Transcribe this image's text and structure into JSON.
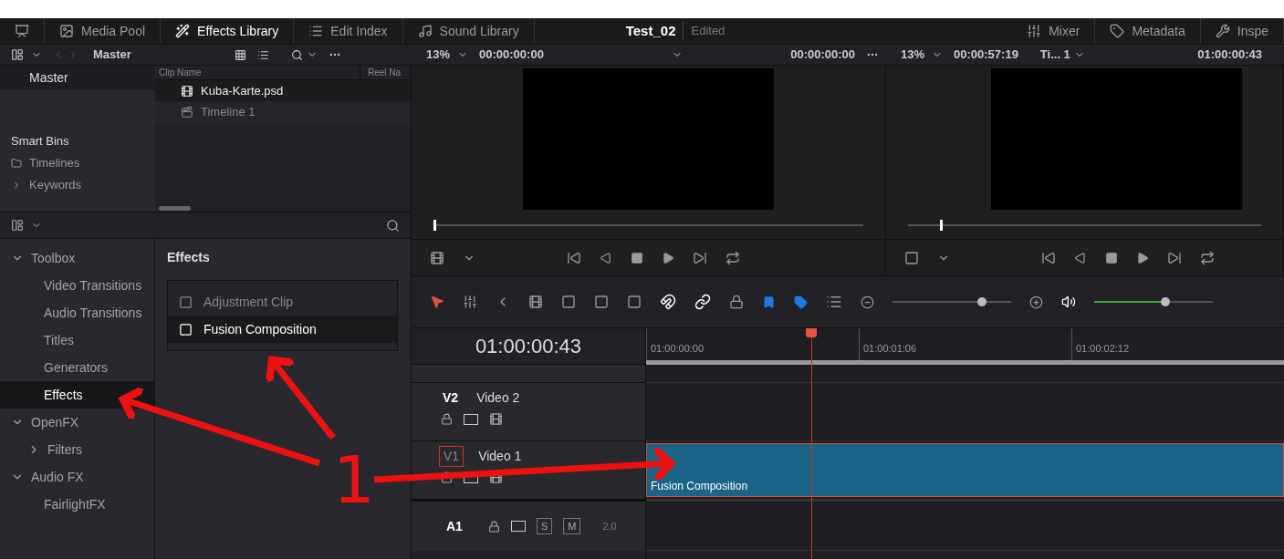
{
  "top_bar": {
    "left_tabs": [
      {
        "label": "Media Pool",
        "selected": false
      },
      {
        "label": "Effects Library",
        "selected": true
      },
      {
        "label": "Edit Index",
        "selected": false
      },
      {
        "label": "Sound Library",
        "selected": false
      }
    ],
    "project_title": "Test_02",
    "project_status": "Edited",
    "right_tabs": [
      {
        "label": "Mixer",
        "selected": false
      },
      {
        "label": "Metadata",
        "selected": false
      },
      {
        "label": "Inspe",
        "selected": false
      }
    ]
  },
  "media_pool": {
    "bin": "Master",
    "sidebar": [
      {
        "label": "Master",
        "kind": "bin",
        "selected": true
      },
      {
        "label": "Smart Bins",
        "kind": "heading"
      },
      {
        "label": "Timelines",
        "kind": "smart"
      },
      {
        "label": "Keywords",
        "kind": "group"
      }
    ],
    "columns": [
      "Clip Name",
      "Reel Na"
    ],
    "clips": [
      {
        "name": "Kuba-Karte.psd",
        "kind": "image",
        "selected": true
      },
      {
        "name": "Timeline 1",
        "kind": "timeline",
        "selected": false
      }
    ]
  },
  "effects_library": {
    "tree": [
      {
        "label": "Toolbox",
        "expanded": true,
        "children": [
          {
            "label": "Video Transitions",
            "selected": false
          },
          {
            "label": "Audio Transitions",
            "selected": false
          },
          {
            "label": "Titles",
            "selected": false
          },
          {
            "label": "Generators",
            "selected": false
          },
          {
            "label": "Effects",
            "selected": true
          }
        ]
      },
      {
        "label": "OpenFX",
        "expanded": true,
        "children": [
          {
            "label": "Filters",
            "expanded": false,
            "selected": false
          }
        ]
      },
      {
        "label": "Audio FX",
        "expanded": true,
        "children": [
          {
            "label": "FairlightFX",
            "selected": false
          }
        ]
      }
    ],
    "heading": "Effects",
    "items": [
      {
        "label": "Adjustment Clip",
        "selected": false
      },
      {
        "label": "Fusion Composition",
        "selected": true
      }
    ]
  },
  "source_viewer": {
    "zoom": "13%",
    "timecode": "00:00:00:00",
    "end_timecode": "00:00:00:00",
    "level": 0.0
  },
  "timeline_viewer": {
    "zoom": "13%",
    "duration": "00:00:57:19",
    "timeline": "Ti... 1",
    "timecode": "01:00:00:43",
    "level": 0.09
  },
  "toolbar": {
    "zoom_slider": {
      "level": 0.75
    },
    "volume_slider": {
      "level": 0.6
    }
  },
  "timeline": {
    "timecode": "01:00:00:43",
    "ruler": [
      "01:00:00:00",
      "01:00:01:06",
      "01:00:02:12"
    ],
    "tracks": [
      {
        "kind": "video",
        "id": "V2",
        "name": "Video 2",
        "selected": false
      },
      {
        "kind": "video",
        "id": "V1",
        "name": "Video 1",
        "selected": true,
        "clips": [
          {
            "label": "Fusion Composition"
          }
        ]
      },
      {
        "kind": "audio",
        "id": "A1",
        "solo": "S",
        "mute": "M",
        "channels": "2.0"
      }
    ]
  },
  "annotation": {
    "label": "1"
  }
}
